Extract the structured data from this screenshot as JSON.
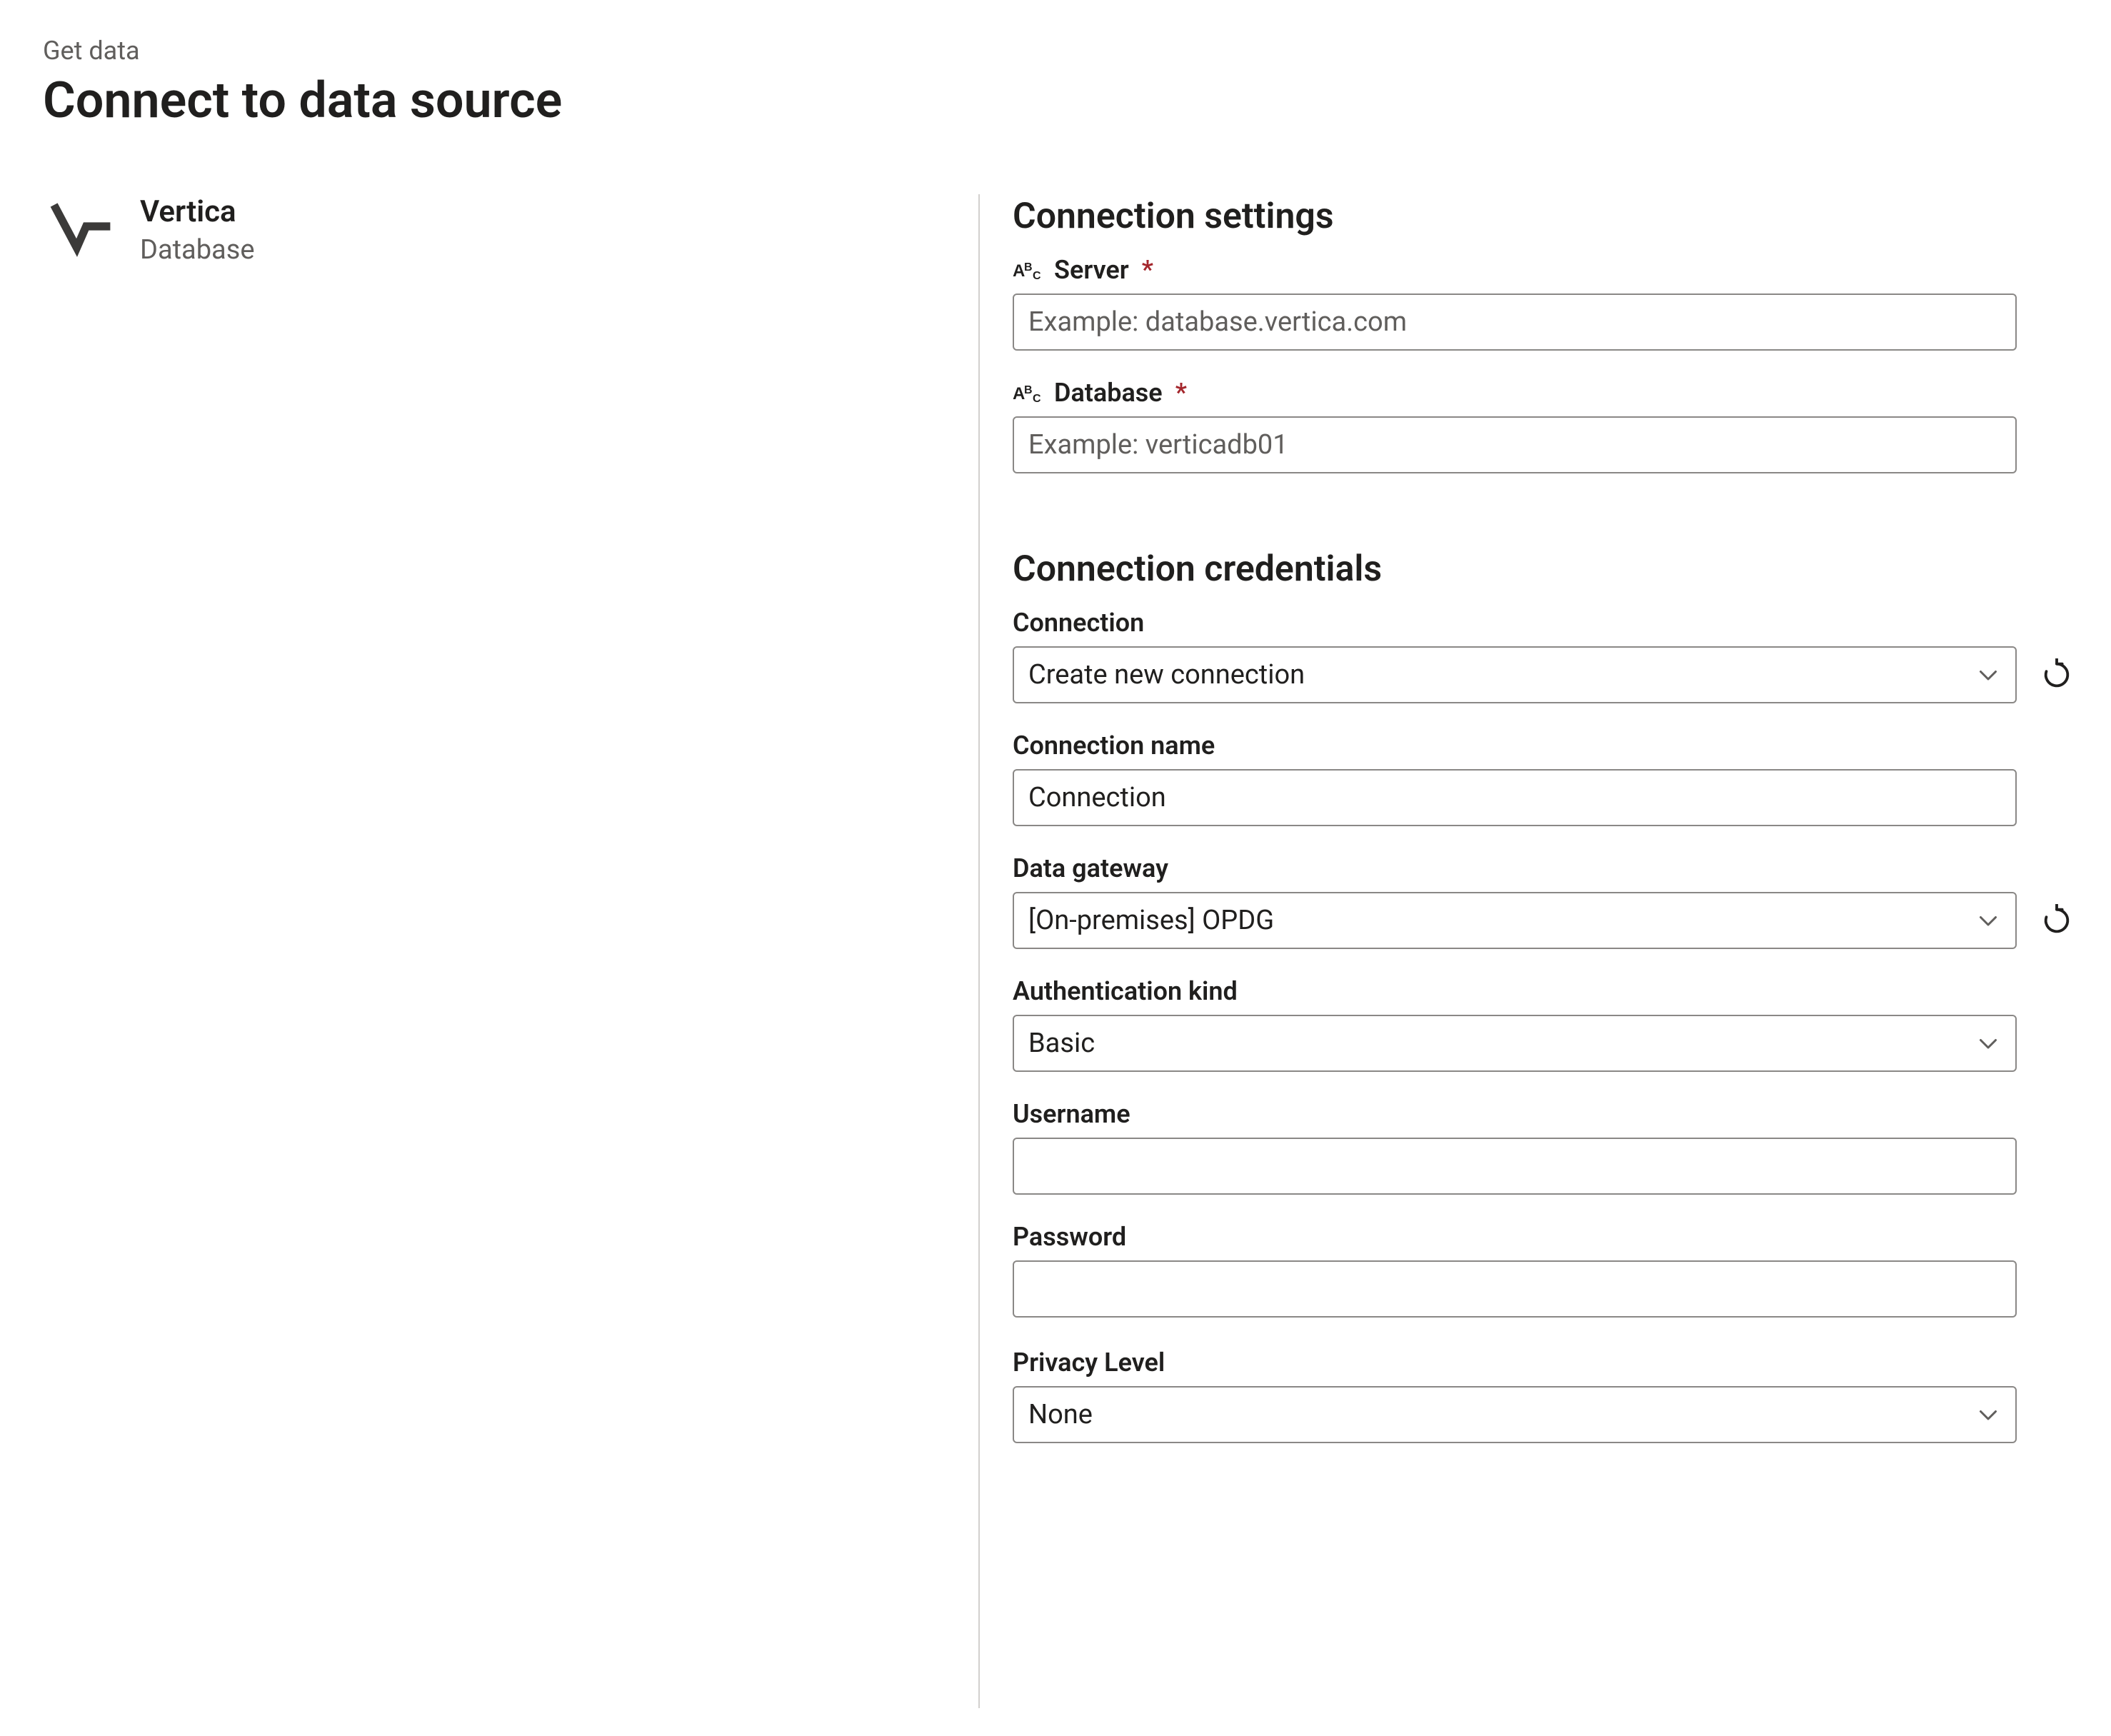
{
  "header": {
    "breadcrumb": "Get data",
    "title": "Connect to data source"
  },
  "source": {
    "name": "Vertica",
    "type": "Database"
  },
  "sections": {
    "settings_title": "Connection settings",
    "credentials_title": "Connection credentials"
  },
  "fields": {
    "server": {
      "label": "Server",
      "required": true,
      "placeholder": "Example: database.vertica.com",
      "value": ""
    },
    "database": {
      "label": "Database",
      "required": true,
      "placeholder": "Example: verticadb01",
      "value": ""
    },
    "connection": {
      "label": "Connection",
      "value": "Create new connection"
    },
    "connection_name": {
      "label": "Connection name",
      "value": "Connection"
    },
    "data_gateway": {
      "label": "Data gateway",
      "value": "[On-premises] OPDG"
    },
    "auth_kind": {
      "label": "Authentication kind",
      "value": "Basic"
    },
    "username": {
      "label": "Username",
      "value": ""
    },
    "password": {
      "label": "Password",
      "value": ""
    },
    "privacy": {
      "label": "Privacy Level",
      "value": "None"
    }
  },
  "symbols": {
    "required": "*"
  }
}
